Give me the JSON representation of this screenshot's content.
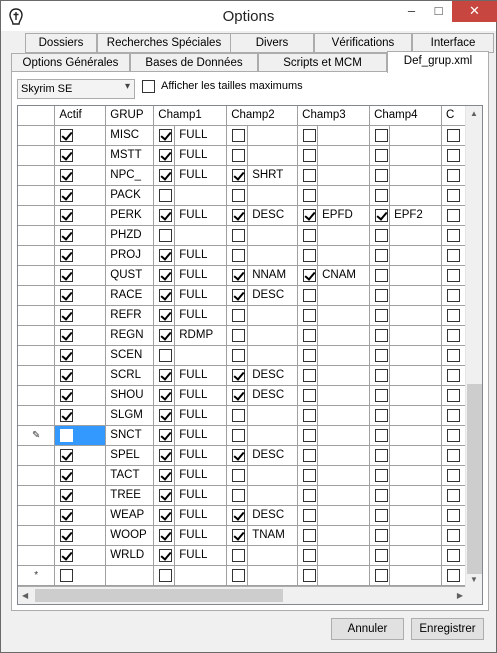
{
  "window": {
    "title": "Options"
  },
  "titlebar": {
    "minimize": "–",
    "maximize": "□",
    "close": "✕"
  },
  "tabs_row1": [
    "Dossiers",
    "Recherches Spéciales",
    "Divers",
    "Vérifications",
    "Interface"
  ],
  "tabs_row2": [
    "Options Générales",
    "Bases de Données",
    "Scripts et MCM",
    "Def_grup.xml"
  ],
  "toolbar": {
    "game_select": "Skyrim SE",
    "show_max_label": "Afficher les tailles maximums",
    "show_max_checked": false
  },
  "grid": {
    "columns": [
      "Actif",
      "GRUP",
      "Champ1",
      "Champ2",
      "Champ3",
      "Champ4",
      "C"
    ],
    "rows": [
      {
        "marker": "",
        "actif": true,
        "grup": "MISC",
        "c1": true,
        "v1": "FULL",
        "c2": false,
        "v2": "",
        "c3": false,
        "v3": "",
        "c4": false,
        "v4": "",
        "c5": false
      },
      {
        "marker": "",
        "actif": true,
        "grup": "MSTT",
        "c1": true,
        "v1": "FULL",
        "c2": false,
        "v2": "",
        "c3": false,
        "v3": "",
        "c4": false,
        "v4": "",
        "c5": false
      },
      {
        "marker": "",
        "actif": true,
        "grup": "NPC_",
        "c1": true,
        "v1": "FULL",
        "c2": true,
        "v2": "SHRT",
        "c3": false,
        "v3": "",
        "c4": false,
        "v4": "",
        "c5": false
      },
      {
        "marker": "",
        "actif": true,
        "grup": "PACK",
        "c1": false,
        "v1": "",
        "c2": false,
        "v2": "",
        "c3": false,
        "v3": "",
        "c4": false,
        "v4": "",
        "c5": false
      },
      {
        "marker": "",
        "actif": true,
        "grup": "PERK",
        "c1": true,
        "v1": "FULL",
        "c2": true,
        "v2": "DESC",
        "c3": true,
        "v3": "EPFD",
        "c4": true,
        "v4": "EPF2",
        "c5": false
      },
      {
        "marker": "",
        "actif": true,
        "grup": "PHZD",
        "c1": false,
        "v1": "",
        "c2": false,
        "v2": "",
        "c3": false,
        "v3": "",
        "c4": false,
        "v4": "",
        "c5": false
      },
      {
        "marker": "",
        "actif": true,
        "grup": "PROJ",
        "c1": true,
        "v1": "FULL",
        "c2": false,
        "v2": "",
        "c3": false,
        "v3": "",
        "c4": false,
        "v4": "",
        "c5": false
      },
      {
        "marker": "",
        "actif": true,
        "grup": "QUST",
        "c1": true,
        "v1": "FULL",
        "c2": true,
        "v2": "NNAM",
        "c3": true,
        "v3": "CNAM",
        "c4": false,
        "v4": "",
        "c5": false
      },
      {
        "marker": "",
        "actif": true,
        "grup": "RACE",
        "c1": true,
        "v1": "FULL",
        "c2": true,
        "v2": "DESC",
        "c3": false,
        "v3": "",
        "c4": false,
        "v4": "",
        "c5": false
      },
      {
        "marker": "",
        "actif": true,
        "grup": "REFR",
        "c1": true,
        "v1": "FULL",
        "c2": false,
        "v2": "",
        "c3": false,
        "v3": "",
        "c4": false,
        "v4": "",
        "c5": false
      },
      {
        "marker": "",
        "actif": true,
        "grup": "REGN",
        "c1": true,
        "v1": "RDMP",
        "c2": false,
        "v2": "",
        "c3": false,
        "v3": "",
        "c4": false,
        "v4": "",
        "c5": false
      },
      {
        "marker": "",
        "actif": true,
        "grup": "SCEN",
        "c1": false,
        "v1": "",
        "c2": false,
        "v2": "",
        "c3": false,
        "v3": "",
        "c4": false,
        "v4": "",
        "c5": false
      },
      {
        "marker": "",
        "actif": true,
        "grup": "SCRL",
        "c1": true,
        "v1": "FULL",
        "c2": true,
        "v2": "DESC",
        "c3": false,
        "v3": "",
        "c4": false,
        "v4": "",
        "c5": false
      },
      {
        "marker": "",
        "actif": true,
        "grup": "SHOU",
        "c1": true,
        "v1": "FULL",
        "c2": true,
        "v2": "DESC",
        "c3": false,
        "v3": "",
        "c4": false,
        "v4": "",
        "c5": false
      },
      {
        "marker": "",
        "actif": true,
        "grup": "SLGM",
        "c1": true,
        "v1": "FULL",
        "c2": false,
        "v2": "",
        "c3": false,
        "v3": "",
        "c4": false,
        "v4": "",
        "c5": false
      },
      {
        "marker": "✎",
        "actif": false,
        "grup": "SNCT",
        "c1": true,
        "v1": "FULL",
        "c2": false,
        "v2": "",
        "c3": false,
        "v3": "",
        "c4": false,
        "v4": "",
        "c5": false,
        "selected": true
      },
      {
        "marker": "",
        "actif": true,
        "grup": "SPEL",
        "c1": true,
        "v1": "FULL",
        "c2": true,
        "v2": "DESC",
        "c3": false,
        "v3": "",
        "c4": false,
        "v4": "",
        "c5": false
      },
      {
        "marker": "",
        "actif": true,
        "grup": "TACT",
        "c1": true,
        "v1": "FULL",
        "c2": false,
        "v2": "",
        "c3": false,
        "v3": "",
        "c4": false,
        "v4": "",
        "c5": false
      },
      {
        "marker": "",
        "actif": true,
        "grup": "TREE",
        "c1": true,
        "v1": "FULL",
        "c2": false,
        "v2": "",
        "c3": false,
        "v3": "",
        "c4": false,
        "v4": "",
        "c5": false
      },
      {
        "marker": "",
        "actif": true,
        "grup": "WEAP",
        "c1": true,
        "v1": "FULL",
        "c2": true,
        "v2": "DESC",
        "c3": false,
        "v3": "",
        "c4": false,
        "v4": "",
        "c5": false
      },
      {
        "marker": "",
        "actif": true,
        "grup": "WOOP",
        "c1": true,
        "v1": "FULL",
        "c2": true,
        "v2": "TNAM",
        "c3": false,
        "v3": "",
        "c4": false,
        "v4": "",
        "c5": false
      },
      {
        "marker": "",
        "actif": true,
        "grup": "WRLD",
        "c1": true,
        "v1": "FULL",
        "c2": false,
        "v2": "",
        "c3": false,
        "v3": "",
        "c4": false,
        "v4": "",
        "c5": false
      },
      {
        "marker": "*",
        "actif": false,
        "grup": "",
        "c1": false,
        "v1": "",
        "c2": false,
        "v2": "",
        "c3": false,
        "v3": "",
        "c4": false,
        "v4": "",
        "c5": false
      }
    ]
  },
  "buttons": {
    "cancel": "Annuler",
    "save": "Enregistrer"
  }
}
